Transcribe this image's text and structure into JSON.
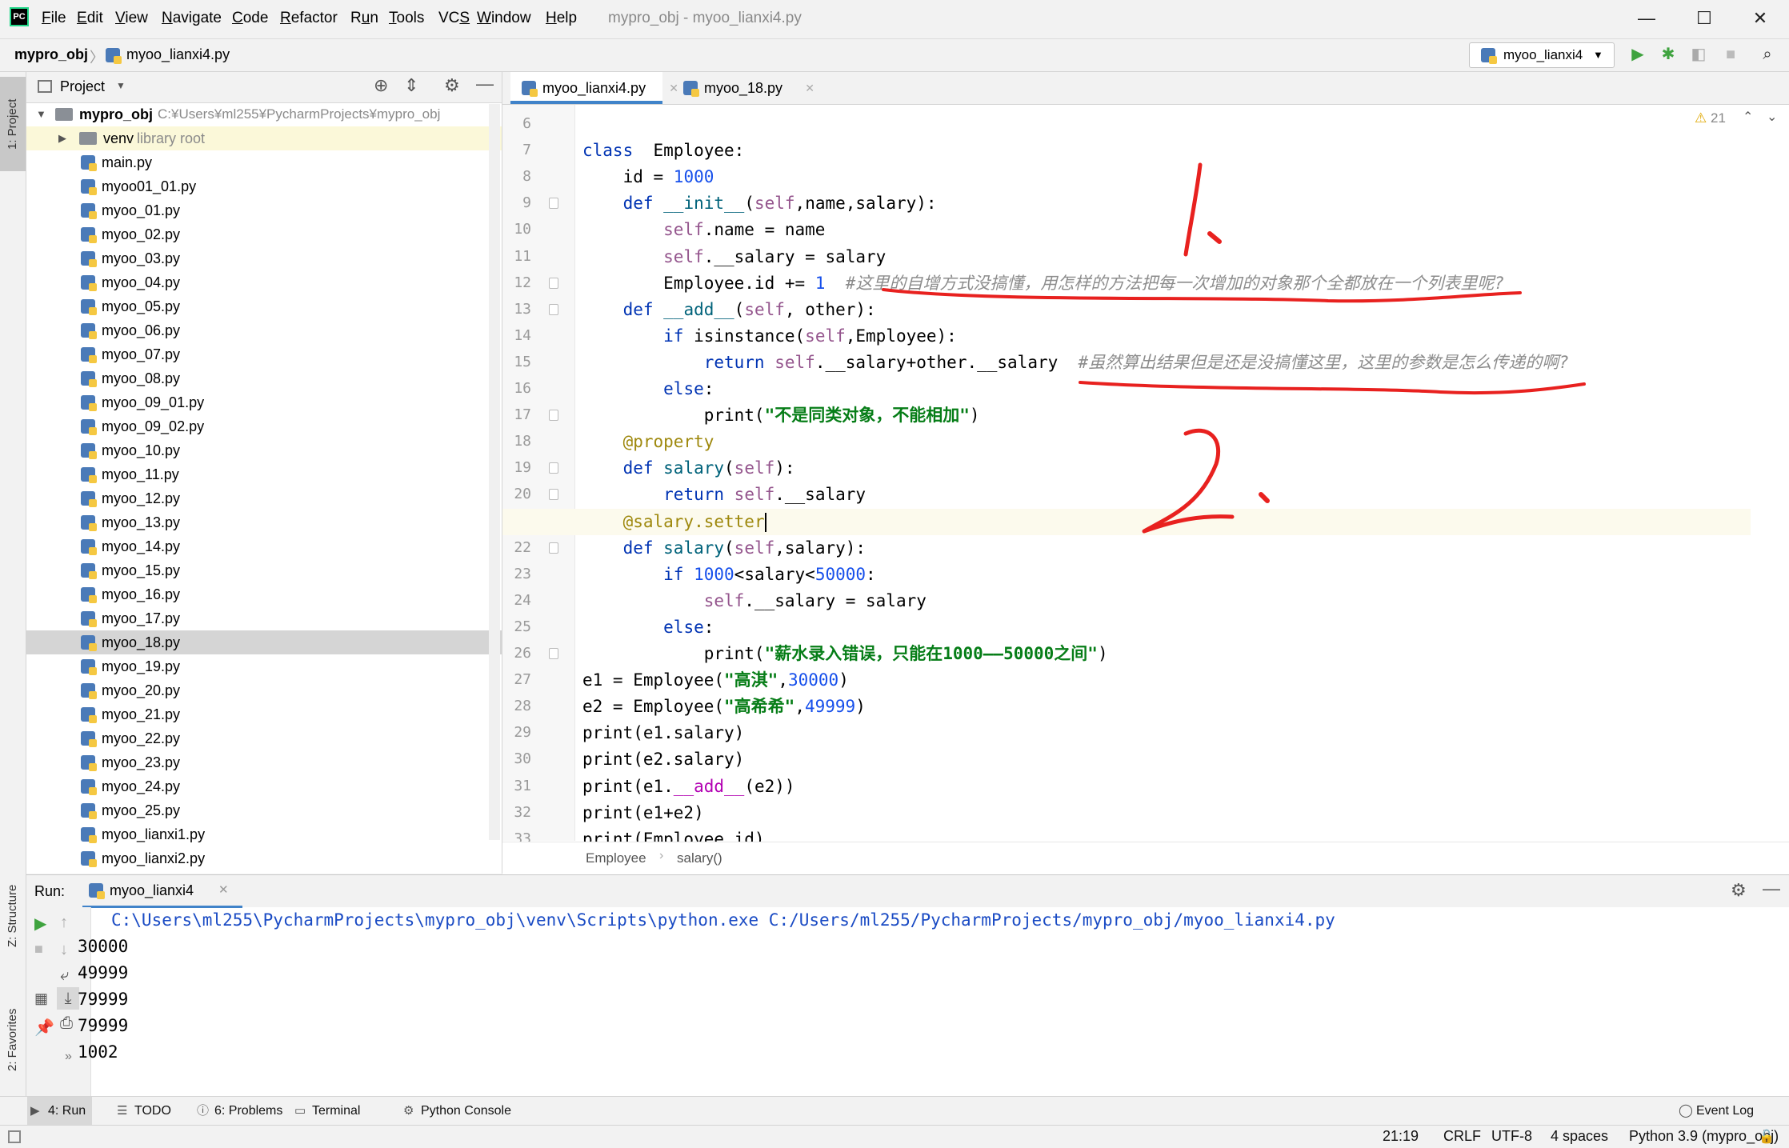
{
  "app": {
    "window_title": "mypro_obj - myoo_lianxi4.py",
    "menu": [
      {
        "label": "File",
        "accel": "F"
      },
      {
        "label": "Edit",
        "accel": "E"
      },
      {
        "label": "View",
        "accel": "V"
      },
      {
        "label": "Navigate",
        "accel": "N"
      },
      {
        "label": "Code",
        "accel": "C"
      },
      {
        "label": "Refactor",
        "accel": "R"
      },
      {
        "label": "Run",
        "accel": "u"
      },
      {
        "label": "Tools",
        "accel": "T"
      },
      {
        "label": "VCS",
        "accel": "S"
      },
      {
        "label": "Window",
        "accel": "W"
      },
      {
        "label": "Help",
        "accel": "H"
      }
    ],
    "win_controls": {
      "minimize": "—",
      "maximize": "☐",
      "close": "✕"
    }
  },
  "navbar": {
    "project": "mypro_obj",
    "separator": "〉",
    "file": "myoo_lianxi4.py",
    "run_config": "myoo_lianxi4",
    "icons": [
      "run-icon",
      "debug-icon",
      "coverage-icon",
      "stop-icon",
      "search-icon"
    ]
  },
  "left_stripe": {
    "project_tab": "1: Project",
    "structure_tab": "Z: Structure",
    "favorites_tab": "2: Favorites"
  },
  "project_panel": {
    "title": "Project",
    "root": {
      "name": "mypro_obj",
      "path": "C:¥Users¥ml255¥PycharmProjects¥mypro_obj"
    },
    "venv": {
      "name": "venv",
      "hint": "library root"
    },
    "files": [
      "main.py",
      "myoo01_01.py",
      "myoo_01.py",
      "myoo_02.py",
      "myoo_03.py",
      "myoo_04.py",
      "myoo_05.py",
      "myoo_06.py",
      "myoo_07.py",
      "myoo_08.py",
      "myoo_09_01.py",
      "myoo_09_02.py",
      "myoo_10.py",
      "myoo_11.py",
      "myoo_12.py",
      "myoo_13.py",
      "myoo_14.py",
      "myoo_15.py",
      "myoo_16.py",
      "myoo_17.py",
      "myoo_18.py",
      "myoo_19.py",
      "myoo_20.py",
      "myoo_21.py",
      "myoo_22.py",
      "myoo_23.py",
      "myoo_24.py",
      "myoo_25.py",
      "myoo_lianxi1.py",
      "myoo_lianxi2.py"
    ],
    "selected_file": "myoo_18.py"
  },
  "editor": {
    "tabs": [
      {
        "label": "myoo_lianxi4.py",
        "active": true
      },
      {
        "label": "myoo_18.py",
        "active": false
      }
    ],
    "warnings": "21",
    "current_line": 21,
    "lines": [
      {
        "n": "6",
        "tokens": []
      },
      {
        "n": "7",
        "tokens": [
          [
            "kw",
            "class"
          ],
          [
            "",
            "  Employee:"
          ]
        ]
      },
      {
        "n": "8",
        "tokens": [
          [
            "",
            "    id = "
          ],
          [
            "num",
            "1000"
          ]
        ]
      },
      {
        "n": "9",
        "tokens": [
          [
            "",
            "    "
          ],
          [
            "kw",
            "def "
          ],
          [
            "fn",
            "__init__"
          ],
          [
            "",
            "("
          ],
          [
            "self",
            "self"
          ],
          [
            "",
            ",name,salary):"
          ]
        ]
      },
      {
        "n": "10",
        "tokens": [
          [
            "",
            "        "
          ],
          [
            "self",
            "self"
          ],
          [
            "",
            ".name = name"
          ]
        ]
      },
      {
        "n": "11",
        "tokens": [
          [
            "",
            "        "
          ],
          [
            "self",
            "self"
          ],
          [
            "",
            ".__salary = salary"
          ]
        ]
      },
      {
        "n": "12",
        "tokens": [
          [
            "",
            "        Employee.id += "
          ],
          [
            "num",
            "1"
          ],
          [
            "",
            "  "
          ],
          [
            "cmt",
            "#这里的自增方式没搞懂，用怎样的方法把每一次增加的对象那个全都放在一个列表里呢?"
          ]
        ]
      },
      {
        "n": "13",
        "tokens": [
          [
            "",
            "    "
          ],
          [
            "kw",
            "def "
          ],
          [
            "fn",
            "__add__"
          ],
          [
            "",
            "("
          ],
          [
            "self",
            "self"
          ],
          [
            "",
            ", other):"
          ]
        ]
      },
      {
        "n": "14",
        "tokens": [
          [
            "",
            "        "
          ],
          [
            "kw",
            "if "
          ],
          [
            "",
            "isinstance("
          ],
          [
            "self",
            "self"
          ],
          [
            "",
            ",Employee):"
          ]
        ]
      },
      {
        "n": "15",
        "tokens": [
          [
            "",
            "            "
          ],
          [
            "kw",
            "return "
          ],
          [
            "self",
            "self"
          ],
          [
            "",
            ".__salary+other.__salary  "
          ],
          [
            "cmt",
            "#虽然算出结果但是还是没搞懂这里，这里的参数是怎么传递的啊?"
          ]
        ]
      },
      {
        "n": "16",
        "tokens": [
          [
            "",
            "        "
          ],
          [
            "kw",
            "else"
          ],
          [
            "",
            ":"
          ]
        ]
      },
      {
        "n": "17",
        "tokens": [
          [
            "",
            "            print("
          ],
          [
            "str",
            "\"不是同类对象，不能相加\""
          ],
          [
            "",
            ")"
          ]
        ]
      },
      {
        "n": "18",
        "tokens": [
          [
            "",
            "    "
          ],
          [
            "dec",
            "@property"
          ]
        ]
      },
      {
        "n": "19",
        "tokens": [
          [
            "",
            "    "
          ],
          [
            "kw",
            "def "
          ],
          [
            "fn",
            "salary"
          ],
          [
            "",
            "("
          ],
          [
            "self",
            "self"
          ],
          [
            "",
            "):"
          ]
        ]
      },
      {
        "n": "20",
        "tokens": [
          [
            "",
            "        "
          ],
          [
            "kw",
            "return "
          ],
          [
            "self",
            "self"
          ],
          [
            "",
            ".__salary"
          ]
        ]
      },
      {
        "n": "21",
        "tokens": [
          [
            "",
            "    "
          ],
          [
            "dec",
            "@salary.setter"
          ]
        ]
      },
      {
        "n": "22",
        "tokens": [
          [
            "",
            "    "
          ],
          [
            "kw",
            "def "
          ],
          [
            "fn",
            "salary"
          ],
          [
            "",
            "("
          ],
          [
            "self",
            "self"
          ],
          [
            "",
            ",salary):"
          ]
        ]
      },
      {
        "n": "23",
        "tokens": [
          [
            "",
            "        "
          ],
          [
            "kw",
            "if "
          ],
          [
            "num",
            "1000"
          ],
          [
            "",
            "<salary<"
          ],
          [
            "num",
            "50000"
          ],
          [
            "",
            ":"
          ]
        ]
      },
      {
        "n": "24",
        "tokens": [
          [
            "",
            "            "
          ],
          [
            "self",
            "self"
          ],
          [
            "",
            ".__salary = salary"
          ]
        ]
      },
      {
        "n": "25",
        "tokens": [
          [
            "",
            "        "
          ],
          [
            "kw",
            "else"
          ],
          [
            "",
            ":"
          ]
        ]
      },
      {
        "n": "26",
        "tokens": [
          [
            "",
            "            print("
          ],
          [
            "str",
            "\"薪水录入错误，只能在1000——50000之间\""
          ],
          [
            "",
            ")"
          ]
        ]
      },
      {
        "n": "27",
        "tokens": [
          [
            "",
            "e1 = Employee("
          ],
          [
            "str",
            "\"高淇\""
          ],
          [
            "",
            ","
          ],
          [
            "num",
            "30000"
          ],
          [
            "",
            ")"
          ]
        ]
      },
      {
        "n": "28",
        "tokens": [
          [
            "",
            "e2 = Employee("
          ],
          [
            "str",
            "\"高希希\""
          ],
          [
            "",
            ","
          ],
          [
            "num",
            "49999"
          ],
          [
            "",
            ")"
          ]
        ]
      },
      {
        "n": "29",
        "tokens": [
          [
            "",
            "print(e1.salary)"
          ]
        ]
      },
      {
        "n": "30",
        "tokens": [
          [
            "",
            "print(e2.salary)"
          ]
        ]
      },
      {
        "n": "31",
        "tokens": [
          [
            "",
            "print(e1."
          ],
          [
            "dund",
            "__add__"
          ],
          [
            "",
            "(e2))"
          ]
        ]
      },
      {
        "n": "32",
        "tokens": [
          [
            "",
            "print(e1+e2)"
          ]
        ]
      },
      {
        "n": "33",
        "tokens": [
          [
            "",
            "print(Employee.id)"
          ]
        ]
      }
    ],
    "breadcrumbs": [
      "Employee",
      "salary()"
    ]
  },
  "run": {
    "label": "Run:",
    "tab": "myoo_lianxi4",
    "command": "C:\\Users\\ml255\\PycharmProjects\\mypro_obj\\venv\\Scripts\\python.exe C:/Users/ml255/PycharmProjects/mypro_obj/myoo_lianxi4.py",
    "output": [
      "30000",
      "49999",
      "79999",
      "79999",
      "1002"
    ]
  },
  "tool_tabs": [
    {
      "label": "4: Run",
      "icon": "run-icon"
    },
    {
      "label": "TODO",
      "icon": "list-icon"
    },
    {
      "label": "6: Problems",
      "icon": "problems-icon"
    },
    {
      "label": "Terminal",
      "icon": "terminal-icon"
    },
    {
      "label": "Python Console",
      "icon": "python-icon"
    }
  ],
  "event_log": "Event Log",
  "status": {
    "position": "21:19",
    "line_sep": "CRLF",
    "encoding": "UTF-8",
    "indent": "4 spaces",
    "interpreter": "Python 3.9 (mypro_obj)"
  },
  "annotations": {
    "mark1": "1.",
    "mark2": "2."
  },
  "colors": {
    "keyword": "#0033b3",
    "function": "#00627a",
    "self": "#94558d",
    "number": "#1750eb",
    "string": "#067d17",
    "comment": "#8c8c8c",
    "decorator": "#9e880d",
    "annotation_red": "#e8211f",
    "selection": "#d5d5d5",
    "accent": "#4083c9"
  }
}
